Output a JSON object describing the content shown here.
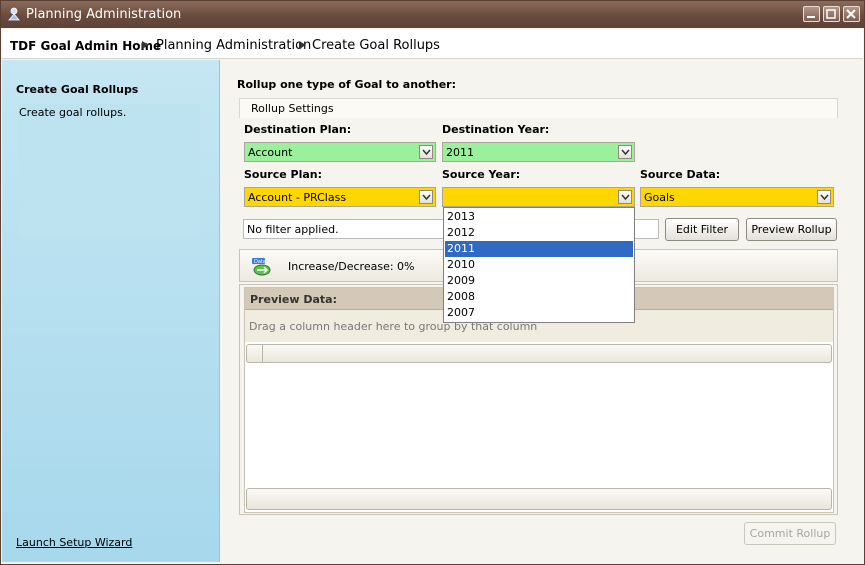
{
  "window": {
    "title": "Planning Administration"
  },
  "breadcrumb": [
    "TDF Goal Admin Home",
    "Planning Administration",
    "Create Goal Rollups"
  ],
  "sidebar": {
    "heading": "Create Goal Rollups",
    "description": "Create goal rollups.",
    "wizard_link": "Launch Setup Wizard"
  },
  "main": {
    "heading": "Rollup one type of Goal to another:",
    "settings_label": "Rollup Settings",
    "destination_plan": {
      "label": "Destination Plan:",
      "value": "Account"
    },
    "destination_year": {
      "label": "Destination Year:",
      "value": "2011"
    },
    "source_plan": {
      "label": "Source Plan:",
      "value": "Account - PRClass"
    },
    "source_year": {
      "label": "Source Year:",
      "value": ""
    },
    "source_data": {
      "label": "Source Data:",
      "value": "Goals"
    },
    "filter_text": "No filter applied.",
    "edit_filter_label": "Edit Filter",
    "preview_rollup_label": "Preview Rollup",
    "increase_decrease": "Increase/Decrease: 0%",
    "preview": {
      "title": "Preview Data:",
      "group_hint": "Drag a column header here to group by that column"
    },
    "commit_label": "Commit Rollup"
  },
  "source_year_options": [
    "2013",
    "2012",
    "2011",
    "2010",
    "2009",
    "2008",
    "2007"
  ],
  "source_year_highlighted": "2011",
  "colors": {
    "accent_green": "#9bf09b",
    "accent_yellow": "#ffd700",
    "sidebar": "#a7d8ec",
    "selection": "#316ac5"
  }
}
